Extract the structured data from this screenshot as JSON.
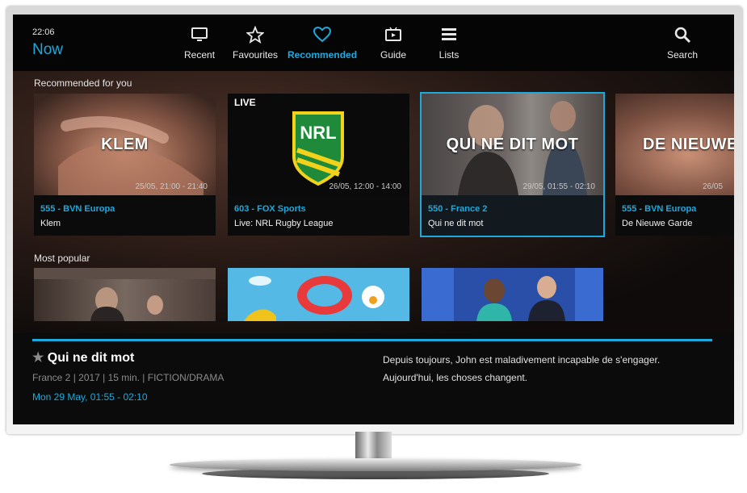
{
  "header": {
    "clock": "22:06",
    "view_title": "Now"
  },
  "nav": [
    {
      "label": "Recent",
      "icon": "tv-icon"
    },
    {
      "label": "Favourites",
      "icon": "star-icon"
    },
    {
      "label": "Recommended",
      "icon": "heart-icon",
      "active": true
    },
    {
      "label": "Guide",
      "icon": "guide-icon"
    },
    {
      "label": "Lists",
      "icon": "list-icon"
    },
    {
      "label": "Search",
      "icon": "search-icon"
    }
  ],
  "recommended": {
    "title": "Recommended for you",
    "cards": [
      {
        "overlay_title": "KLEM",
        "time": "25/05, 21:00 - 21:40",
        "channel": "555 - BVN Europa",
        "program": "Klem"
      },
      {
        "badge": "LIVE",
        "logo_text": "NRL",
        "time": "26/05, 12:00 - 14:00",
        "channel": "603 - FOX Sports",
        "program": "Live: NRL Rugby League"
      },
      {
        "overlay_title": "QUI NE DIT MOT",
        "time": "29/05, 01:55 - 02:10",
        "channel": "550 - France 2",
        "program": "Qui ne dit mot",
        "selected": true
      },
      {
        "overlay_title": "DE NIEUWE GA",
        "time": "26/05",
        "channel": "555 - BVN Europa",
        "program": "De Nieuwe Garde"
      }
    ]
  },
  "popular": {
    "title": "Most popular"
  },
  "detail": {
    "star": "★",
    "title": "Qui ne dit mot",
    "meta": "France 2 | 2017 | 15 min. | FICTION/DRAMA",
    "date": "Mon 29 May, 01:55 - 02:10",
    "description": "Depuis toujours, John est maladivement incapable de s'engager. Aujourd'hui, les choses changent."
  },
  "colors": {
    "accent": "#1ea9dc",
    "background": "#0b0b0b"
  }
}
